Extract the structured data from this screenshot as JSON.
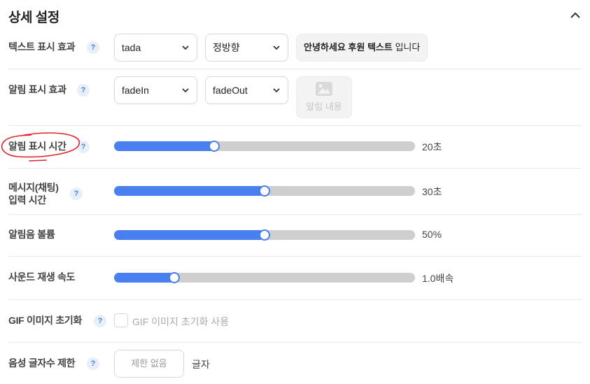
{
  "header": {
    "title": "상세 설정"
  },
  "help_mark": "?",
  "text_effect": {
    "label": "텍스트 표시 효과",
    "effect_select": "tada",
    "direction_select": "정방향",
    "preview": {
      "part1": "안녕하세요 후원 텍스트",
      "part2": " 입니다"
    }
  },
  "alert_effect": {
    "label": "알림 표시 효과",
    "in_select": "fadeIn",
    "out_select": "fadeOut",
    "preview_caption": "알림 내용"
  },
  "sliders": [
    {
      "label": "알림 표시 시간",
      "value": 20,
      "max": 60,
      "display": "20초"
    },
    {
      "label_line1": "메시지(채팅)",
      "label_line2": "입력 시간",
      "value": 30,
      "max": 60,
      "display": "30초"
    },
    {
      "label": "알림음 볼륨",
      "value": 50,
      "max": 100,
      "display": "50%"
    },
    {
      "label": "사운드 재생 속도",
      "value": 1.0,
      "max": 5.0,
      "display": "1.0배속"
    }
  ],
  "gif_reset": {
    "label": "GIF 이미지 초기화",
    "checkbox_label": "GIF 이미지 초기화 사용",
    "checked": false
  },
  "voice_limit": {
    "label": "음성 글자수 제한",
    "placeholder": "제한 없음",
    "unit": "글자"
  },
  "colors": {
    "accent": "#4a7ff0",
    "track": "#cfcfcf",
    "annotation": "#e0242a"
  },
  "icons": {
    "collapse": "chevron-up-icon",
    "select": "chevron-down-icon",
    "help": "question-icon",
    "image": "image-icon"
  }
}
